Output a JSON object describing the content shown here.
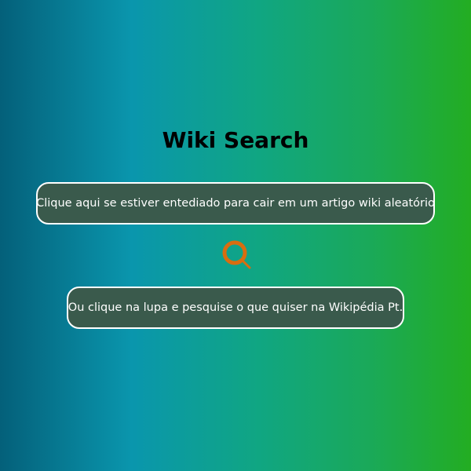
{
  "page": {
    "title": "Wiki Search"
  },
  "random_button": {
    "label": "Clique aqui se estiver entediado para cair em um artigo wiki aleatório"
  },
  "search_button": {
    "icon": "search-icon",
    "color": "#d86d10"
  },
  "search_hint": {
    "label": "Ou clique na lupa e pesquise o que quiser na Wikipédia Pt."
  },
  "colors": {
    "button_bg": "#3a5a4c",
    "button_border": "#ffffff",
    "gradient_start": "#04607a",
    "gradient_mid": "#0a96ad",
    "gradient_end": "#23ad22"
  }
}
